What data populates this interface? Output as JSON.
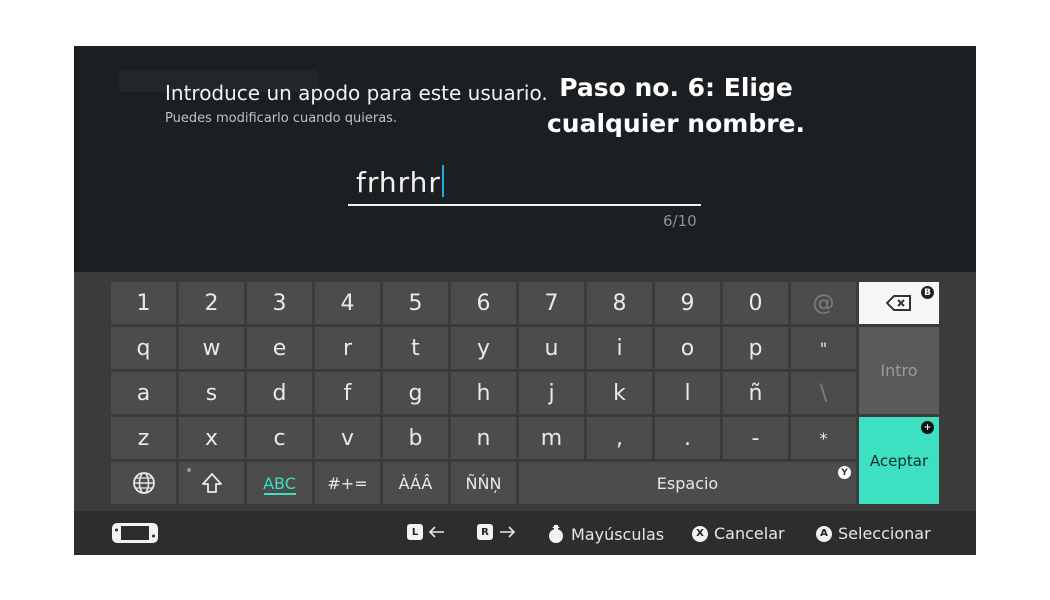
{
  "header": {
    "prompt": "Introduce un apodo para este usuario.",
    "subtext": "Puedes modificarlo cuando quieras.",
    "overlay_line1": "Paso no. 6: Elige",
    "overlay_line2": "cualquier nombre."
  },
  "input": {
    "value": "frhrhr",
    "counter": "6/10"
  },
  "keyboard": {
    "row1": [
      "1",
      "2",
      "3",
      "4",
      "5",
      "6",
      "7",
      "8",
      "9",
      "0",
      "@"
    ],
    "row2": [
      "q",
      "w",
      "e",
      "r",
      "t",
      "y",
      "u",
      "i",
      "o",
      "p",
      "\""
    ],
    "row3": [
      "a",
      "s",
      "d",
      "f",
      "g",
      "h",
      "j",
      "k",
      "l",
      "ñ",
      "\\"
    ],
    "row4": [
      "z",
      "x",
      "c",
      "v",
      "b",
      "n",
      "m",
      ",",
      ".",
      "-",
      "*"
    ],
    "backspace_badge": "B",
    "intro_label": "Intro",
    "accept_label": "Aceptar",
    "accept_badge": "+",
    "abc_label": "ABC",
    "symbols_label": "#+=",
    "accents_label": "ÀÁÂ",
    "ntilde_label": "ÑŃŅ",
    "space_label": "Espacio",
    "space_badge": "Y"
  },
  "footer": {
    "l_badge": "L",
    "r_badge": "R",
    "caps_label": "Mayúsculas",
    "cancel_badge": "X",
    "cancel_label": "Cancelar",
    "select_badge": "A",
    "select_label": "Seleccionar"
  },
  "colors": {
    "accent": "#3de0c0",
    "caret": "#2aa6e0",
    "top_bg": "#1b1f22",
    "kb_bg": "#3b3b3b"
  }
}
